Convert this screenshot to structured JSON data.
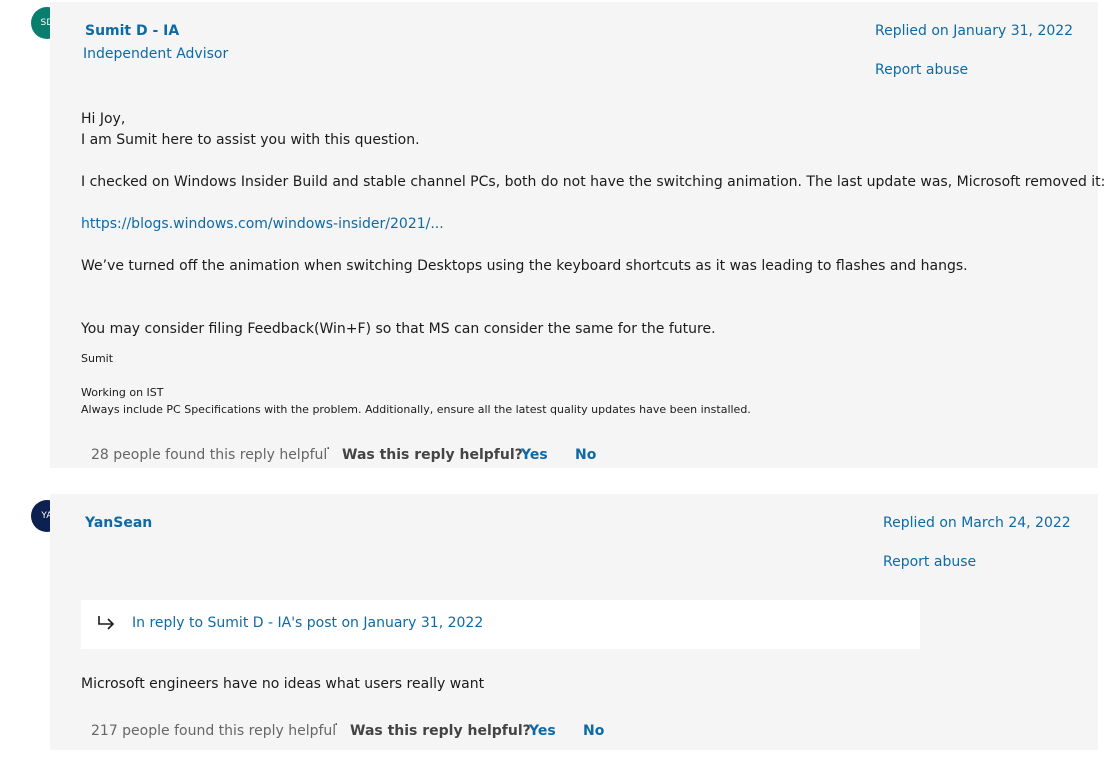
{
  "posts": [
    {
      "avatar_initials": "SD",
      "avatar_color": "#0a7e6e",
      "author": "Sumit D - IA",
      "role": "Independent Advisor",
      "replied": "Replied on January 31, 2022",
      "report": "Report abuse",
      "greeting": "Hi Joy,",
      "intro": "I am Sumit here to assist you with this question.",
      "para1": "I checked on Windows Insider Build and stable channel PCs, both do not have the switching animation. The last update was, Microsoft removed it:",
      "link": "https://blogs.windows.com/windows-insider/2021/...",
      "para2": "We’ve turned off the animation when switching Desktops using the keyboard shortcuts as it was leading to flashes and hangs.",
      "para3": "You may consider filing Feedback(Win+F) so that MS can consider the same for the future.",
      "sig_name": "Sumit",
      "sig_line1": "Working on IST",
      "sig_line2": "Always include PC Specifications with the problem. Additionally, ensure all the latest quality updates have been installed.",
      "helpful_count": "28 people found this reply helpful",
      "separator": "·",
      "helpful_question": "Was this reply helpful?",
      "yes": "Yes",
      "no": "No"
    },
    {
      "avatar_initials": "YA",
      "avatar_color": "#0c2150",
      "author": "YanSean",
      "replied": "Replied on March 24, 2022",
      "report": "Report abuse",
      "in_reply_to": "In reply to Sumit D - IA's post on January 31, 2022",
      "text": "Microsoft engineers have no ideas what users really want",
      "helpful_count": "217 people found this reply helpful",
      "separator": "·",
      "helpful_question": "Was this reply helpful?",
      "yes": "Yes",
      "no": "No"
    }
  ]
}
